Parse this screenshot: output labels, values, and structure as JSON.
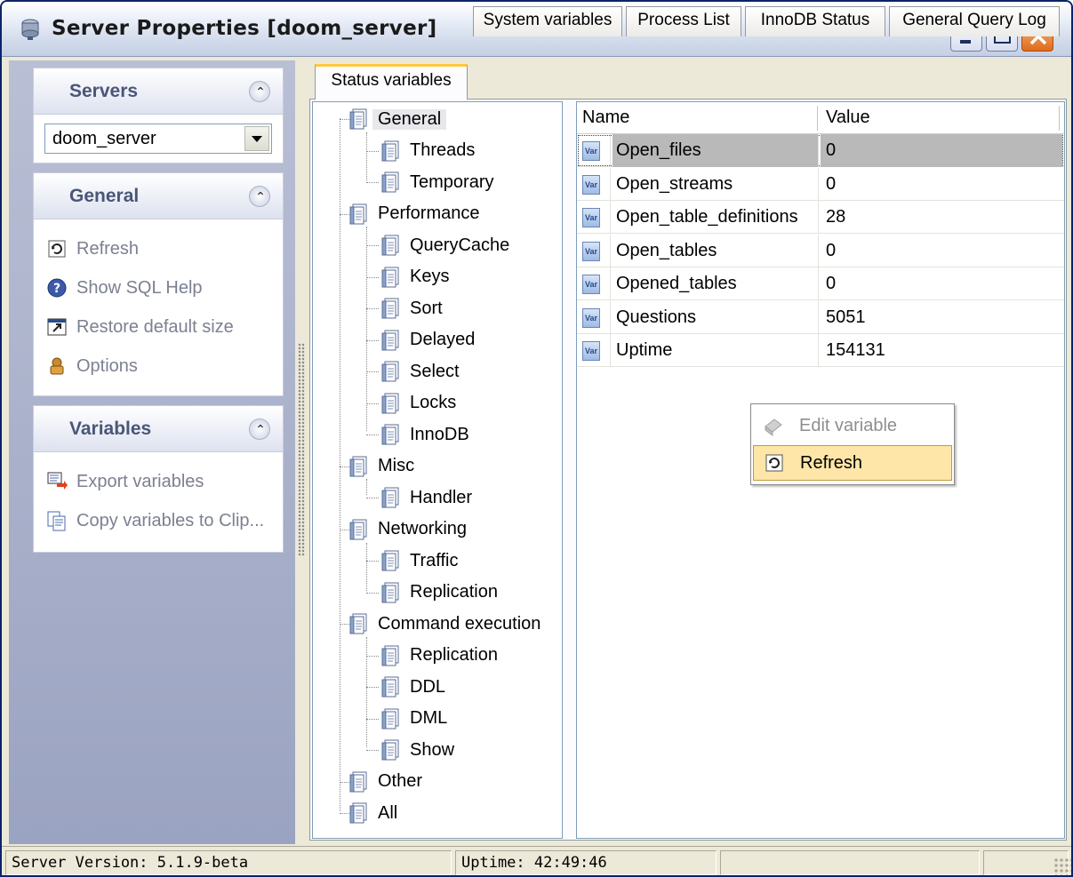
{
  "window": {
    "title": "Server Properties [doom_server]",
    "icon": "server-icon"
  },
  "sidebar": {
    "servers": {
      "title": "Servers",
      "selected_server": "doom_server"
    },
    "general": {
      "title": "General",
      "items": [
        {
          "label": "Refresh",
          "icon": "refresh-icon"
        },
        {
          "label": "Show SQL Help",
          "icon": "help-icon"
        },
        {
          "label": "Restore default size",
          "icon": "restore-size-icon"
        },
        {
          "label": "Options",
          "icon": "options-icon"
        }
      ]
    },
    "variables": {
      "title": "Variables",
      "items": [
        {
          "label": "Export variables",
          "icon": "export-icon"
        },
        {
          "label": "Copy variables to Clip...",
          "icon": "copy-icon"
        }
      ]
    }
  },
  "tabs": [
    {
      "label": "Status variables",
      "active": true
    },
    {
      "label": "System variables",
      "active": false
    },
    {
      "label": "Process List",
      "active": false
    },
    {
      "label": "InnoDB Status",
      "active": false
    },
    {
      "label": "General Query Log",
      "active": false
    }
  ],
  "tree": {
    "nodes": [
      {
        "label": "General",
        "level": 0,
        "selected": true
      },
      {
        "label": "Threads",
        "level": 1
      },
      {
        "label": "Temporary",
        "level": 1
      },
      {
        "label": "Performance",
        "level": 0
      },
      {
        "label": "QueryCache",
        "level": 1
      },
      {
        "label": "Keys",
        "level": 1
      },
      {
        "label": "Sort",
        "level": 1
      },
      {
        "label": "Delayed",
        "level": 1
      },
      {
        "label": "Select",
        "level": 1
      },
      {
        "label": "Locks",
        "level": 1
      },
      {
        "label": "InnoDB",
        "level": 1
      },
      {
        "label": "Misc",
        "level": 0
      },
      {
        "label": "Handler",
        "level": 1
      },
      {
        "label": "Networking",
        "level": 0
      },
      {
        "label": "Traffic",
        "level": 1
      },
      {
        "label": "Replication",
        "level": 1
      },
      {
        "label": "Command execution",
        "level": 0
      },
      {
        "label": "Replication",
        "level": 1
      },
      {
        "label": "DDL",
        "level": 1
      },
      {
        "label": "DML",
        "level": 1
      },
      {
        "label": "Show",
        "level": 1
      },
      {
        "label": "Other",
        "level": 0
      },
      {
        "label": "All",
        "level": 0
      }
    ]
  },
  "grid": {
    "columns": [
      "Name",
      "Value"
    ],
    "row_icon_text": "Var",
    "rows": [
      {
        "name": "Open_files",
        "value": "0",
        "selected": true
      },
      {
        "name": "Open_streams",
        "value": "0"
      },
      {
        "name": "Open_table_definitions",
        "value": "28"
      },
      {
        "name": "Open_tables",
        "value": "0"
      },
      {
        "name": "Opened_tables",
        "value": "0"
      },
      {
        "name": "Questions",
        "value": "5051"
      },
      {
        "name": "Uptime",
        "value": "154131"
      }
    ]
  },
  "context_menu": {
    "items": [
      {
        "label": "Edit variable",
        "icon": "edit-variable-icon",
        "disabled": true
      },
      {
        "label": "Refresh",
        "icon": "refresh-icon",
        "highlighted": true
      }
    ]
  },
  "statusbar": {
    "version": "Server Version: 5.1.9-beta",
    "uptime": "Uptime: 42:49:46"
  },
  "colors": {
    "sidebar_gradient_top": "#b9bfd4",
    "active_tab_accent": "#ffc83c",
    "menu_highlight": "#fee5a8",
    "row_selected": "#b9b9b9"
  }
}
